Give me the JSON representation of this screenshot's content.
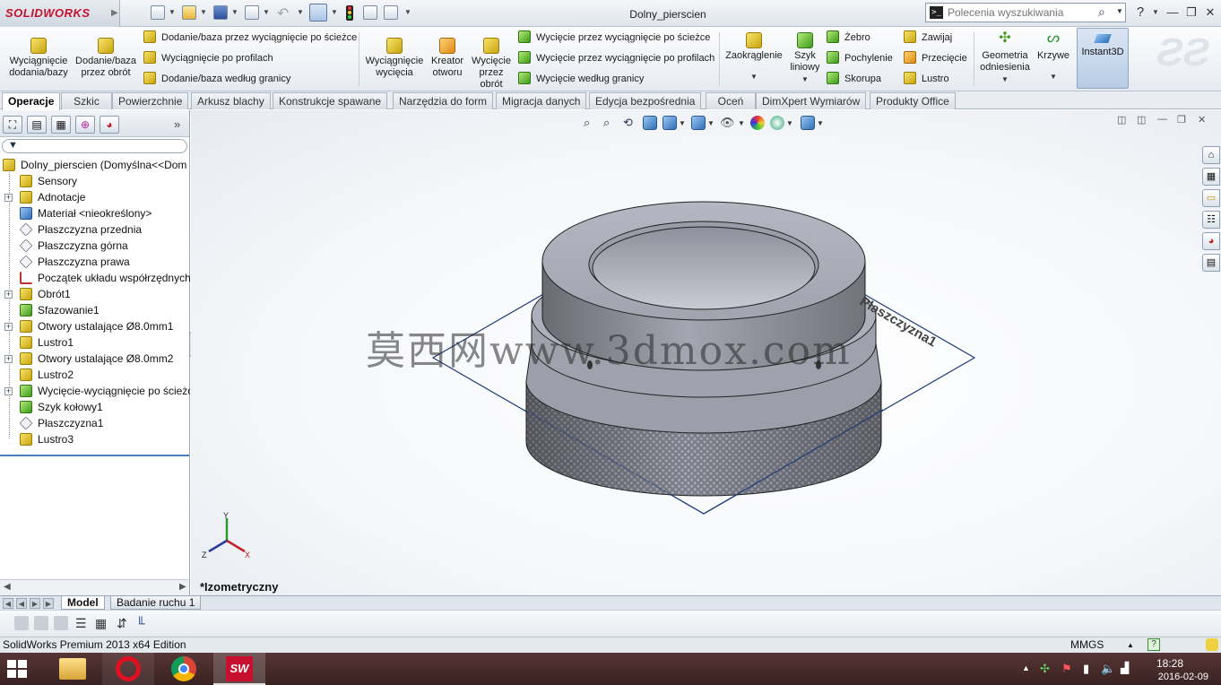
{
  "app": {
    "logo_text": "SOLIDWORKS",
    "document_title": "Dolny_pierscien"
  },
  "search": {
    "placeholder": "Polecenia wyszukiwania",
    "help_label": "?"
  },
  "ribbon": {
    "extrude_boss": "Wyciągnięcie dodania/bazy",
    "revolve_boss": "Dodanie/baza przez obrót",
    "swept_boss": "Dodanie/baza przez wyciągnięcie po ścieżce",
    "lofted_boss": "Wyciągnięcie po profilach",
    "boundary_boss": "Dodanie/baza według granicy",
    "extrude_cut": "Wyciągnięcie wycięcia",
    "hole_wizard": "Kreator otworu",
    "revolve_cut": "Wycięcie przez obrót",
    "swept_cut": "Wycięcie przez wyciągnięcie po ścieżce",
    "lofted_cut": "Wycięcie przez wyciągnięcie po profilach",
    "boundary_cut": "Wycięcie według granicy",
    "fillet": "Zaokrąglenie",
    "linear_pattern": "Szyk liniowy",
    "rib": "Żebro",
    "draft": "Pochylenie",
    "shell": "Skorupa",
    "wrap": "Zawijaj",
    "intersect": "Przecięcie",
    "mirror": "Lustro",
    "reference_geometry": "Geometria odniesienia",
    "curves": "Krzywe",
    "instant3d": "Instant3D"
  },
  "tabs": [
    "Operacje",
    "Szkic",
    "Powierzchnie",
    "Arkusz blachy",
    "Konstrukcje spawane",
    "Narzędzia do form",
    "Migracja danych",
    "Edycja bezpośrednia",
    "Oceń",
    "DimXpert Wymiarów",
    "Produkty Office"
  ],
  "tree": {
    "root": "Dolny_pierscien  (Domyślna<<Dom",
    "items": [
      {
        "label": "Sensory",
        "icon": "sensor-icon",
        "expandable": false
      },
      {
        "label": "Adnotacje",
        "icon": "annotation-icon",
        "expandable": true
      },
      {
        "label": "Materiał <nieokreślony>",
        "icon": "material-icon",
        "expandable": false
      },
      {
        "label": "Płaszczyzna przednia",
        "icon": "plane-icon",
        "expandable": false
      },
      {
        "label": "Płaszczyzna górna",
        "icon": "plane-icon",
        "expandable": false
      },
      {
        "label": "Płaszczyzna prawa",
        "icon": "plane-icon",
        "expandable": false
      },
      {
        "label": "Początek układu współrzędnych",
        "icon": "origin-icon",
        "expandable": false
      },
      {
        "label": "Obrót1",
        "icon": "revolve-icon",
        "expandable": true
      },
      {
        "label": "Sfazowanie1",
        "icon": "chamfer-icon",
        "expandable": false
      },
      {
        "label": "Otwory ustalające Ø8.0mm1",
        "icon": "hole-icon",
        "expandable": true
      },
      {
        "label": "Lustro1",
        "icon": "mirror-icon",
        "expandable": false
      },
      {
        "label": "Otwory ustalające Ø8.0mm2",
        "icon": "hole-icon",
        "expandable": true
      },
      {
        "label": "Lustro2",
        "icon": "mirror-icon",
        "expandable": false
      },
      {
        "label": "Wycięcie-wyciągnięcie po ścieżc",
        "icon": "sweep-cut-icon",
        "expandable": true
      },
      {
        "label": "Szyk kołowy1",
        "icon": "circular-pattern-icon",
        "expandable": false
      },
      {
        "label": "Płaszczyzna1",
        "icon": "plane-icon",
        "expandable": false
      },
      {
        "label": "Lustro3",
        "icon": "mirror-icon",
        "expandable": false
      }
    ]
  },
  "viewport": {
    "view_name": "*Izometryczny",
    "plane_label": "Płaszczyzna1",
    "watermark": "莫西网www.3dmox.com",
    "triad": {
      "x": "X",
      "y": "Y",
      "z": "Z"
    }
  },
  "bottom_tabs": [
    "Model",
    "Badanie ruchu 1"
  ],
  "status": {
    "edition": "SolidWorks Premium 2013 x64 Edition",
    "units": "MMGS"
  },
  "taskbar": {
    "time": "18:28",
    "date": "2016-02-09"
  },
  "colors": {
    "accent": "#c8102e",
    "taskbar": "#4a2c2c",
    "part_gray": "#a7a9b4"
  }
}
